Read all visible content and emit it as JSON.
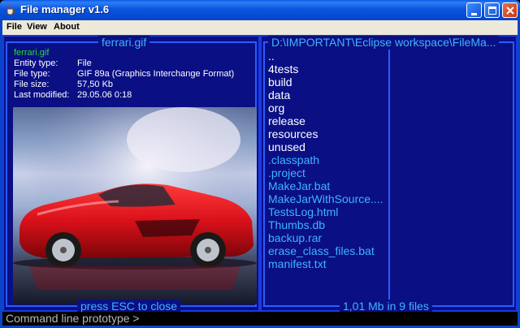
{
  "window": {
    "title": "File manager v1.6"
  },
  "menu": {
    "items": [
      "File",
      "View",
      "About"
    ]
  },
  "left_panel": {
    "title": "ferrari.gif",
    "file_name": "ferrari.gif",
    "info": [
      {
        "key": "Entity type:",
        "value": "File"
      },
      {
        "key": "File type:",
        "value": "GIF 89a (Graphics Interchange Format)"
      },
      {
        "key": "File size:",
        "value": "57,50 Kb"
      },
      {
        "key": "Last modified:",
        "value": "29.05.06 0:18"
      }
    ],
    "footer": "press ESC to close",
    "preview_subject": "red-sports-car"
  },
  "right_panel": {
    "title": "D:\\IMPORTANT\\Eclipse workspace\\FileMa...",
    "entries": [
      {
        "name": "..",
        "kind": "dir"
      },
      {
        "name": "4tests",
        "kind": "dir"
      },
      {
        "name": "build",
        "kind": "dir"
      },
      {
        "name": "data",
        "kind": "dir"
      },
      {
        "name": "org",
        "kind": "dir"
      },
      {
        "name": "release",
        "kind": "dir"
      },
      {
        "name": "resources",
        "kind": "dir"
      },
      {
        "name": "unused",
        "kind": "dir"
      },
      {
        "name": ".classpath",
        "kind": "file"
      },
      {
        "name": ".project",
        "kind": "file"
      },
      {
        "name": "MakeJar.bat",
        "kind": "file"
      },
      {
        "name": "MakeJarWithSource....",
        "kind": "file"
      },
      {
        "name": "TestsLog.html",
        "kind": "file"
      },
      {
        "name": "Thumbs.db",
        "kind": "file"
      },
      {
        "name": "backup.rar",
        "kind": "file"
      },
      {
        "name": "erase_class_files.bat",
        "kind": "file"
      },
      {
        "name": "manifest.txt",
        "kind": "file"
      }
    ],
    "footer": "1,01 Mb in 9 files"
  },
  "command_line": {
    "text": "Command line prototype >"
  },
  "colors": {
    "panel_bg": "#0a0f84",
    "panel_border": "#2a5cff",
    "dir_text": "#ffffff",
    "file_text": "#3fb4ff",
    "selected_name": "#22dd33"
  },
  "icons": [
    "java-cup-icon",
    "minimize-icon",
    "maximize-icon",
    "close-icon"
  ]
}
